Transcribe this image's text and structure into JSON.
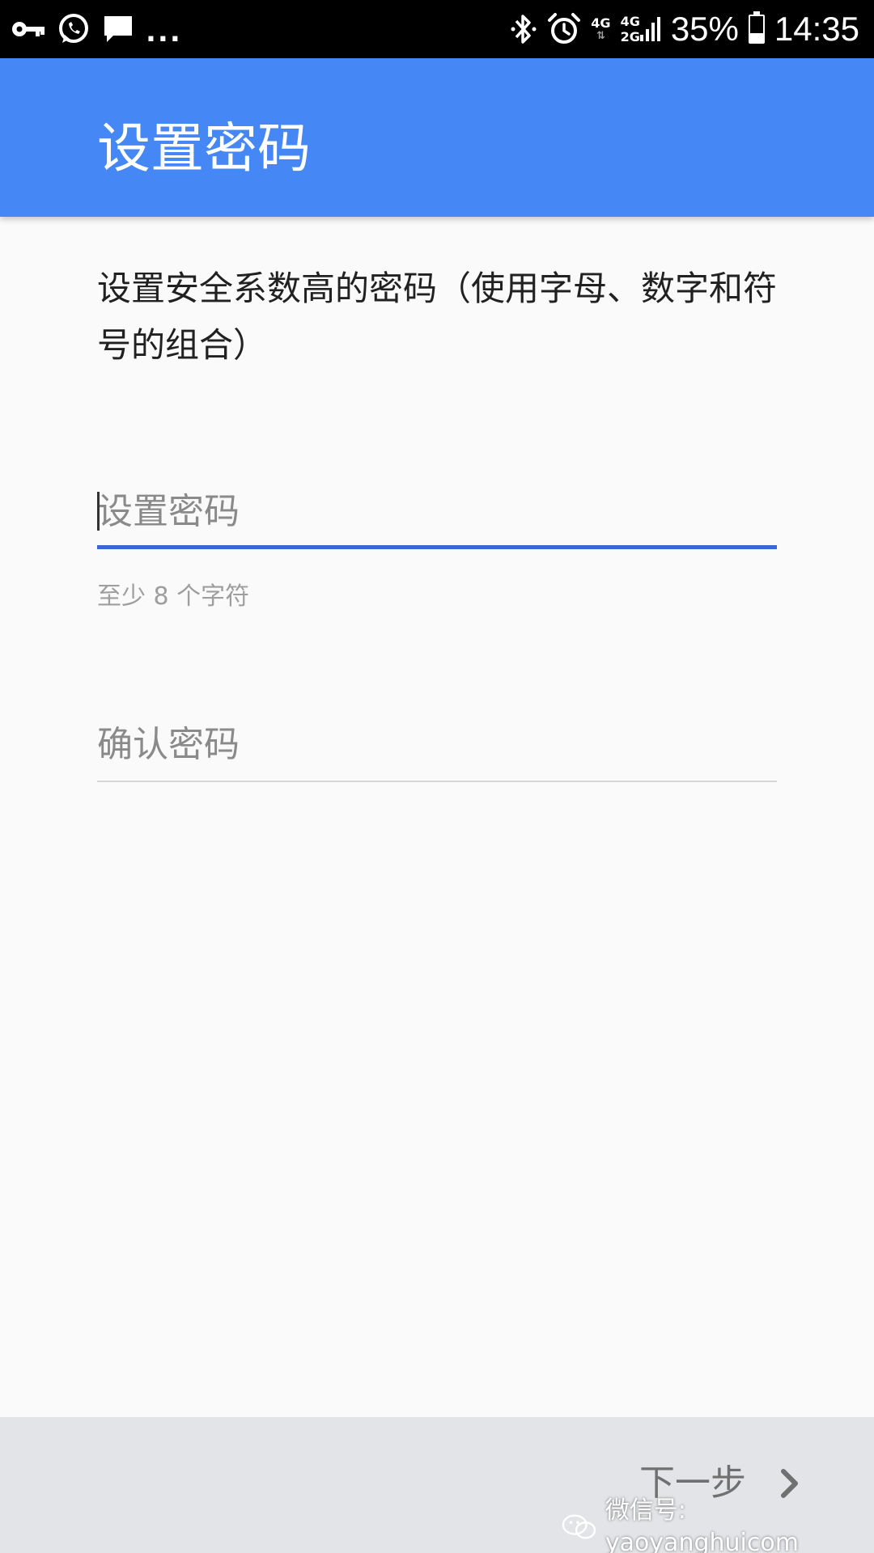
{
  "status_bar": {
    "icons_left": [
      "key-icon",
      "whatsapp-icon",
      "message-icon"
    ],
    "overflow": "...",
    "icons_right": [
      "bluetooth-icon",
      "alarm-icon"
    ],
    "network_1": "4G",
    "network_2_top": "4G",
    "network_2_bottom": "2G",
    "battery_percent": "35%",
    "battery_level": 0.35,
    "time": "14:35"
  },
  "app_bar": {
    "title": "设置密码",
    "color": "#4587f4"
  },
  "content": {
    "description": "设置安全系数高的密码（使用字母、数字和符号的组合）",
    "password_field": {
      "placeholder": "设置密码",
      "value": "",
      "focused": true
    },
    "password_hint": "至少 8 个字符",
    "confirm_field": {
      "placeholder": "确认密码",
      "value": ""
    }
  },
  "bottom_bar": {
    "next_label": "下一步",
    "next_icon": "chevron-right-icon",
    "watermark": "微信号: yaoyanghuicom"
  },
  "colors": {
    "accent": "#3d63d8",
    "background": "#fafafa",
    "bottom_bar": "#e3e4e7"
  }
}
